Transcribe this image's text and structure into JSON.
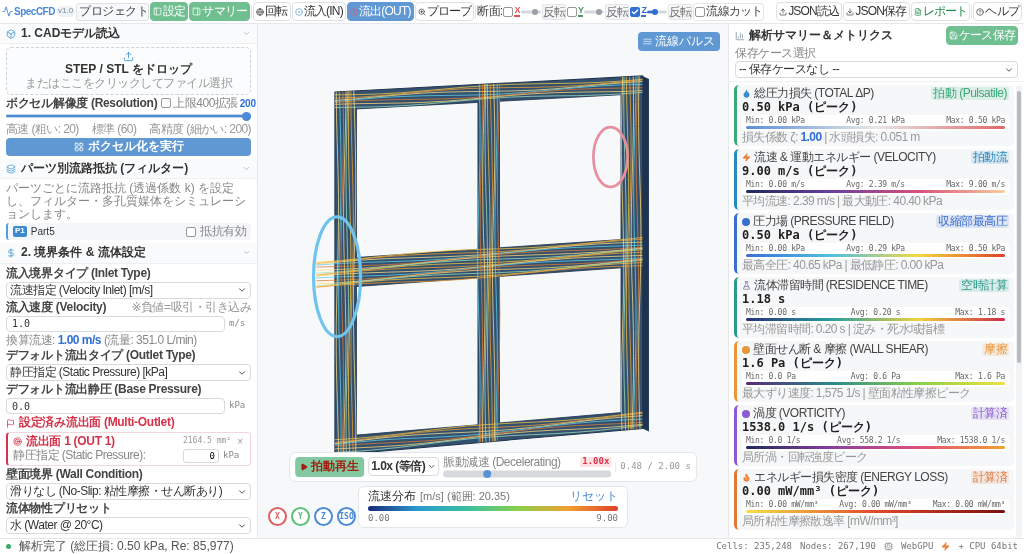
{
  "app": {
    "name": "SpecCFD",
    "version": "v1.0",
    "project": "プロジェクト"
  },
  "toolbar": {
    "panel_buttons": [
      {
        "label": "設定",
        "on": true
      },
      {
        "label": "サマリー",
        "on": true
      }
    ],
    "modes": [
      {
        "label": "回転",
        "kind": "globe",
        "selected": false
      },
      {
        "label": "流入(IN)",
        "kind": "inlet",
        "selected": false
      },
      {
        "label": "流出(OUT)",
        "kind": "outlet",
        "selected": true
      },
      {
        "label": "プローブ",
        "kind": "probe",
        "selected": false
      }
    ],
    "section_label": "断面:",
    "sections": [
      {
        "axis": "X",
        "color": "#e05555",
        "checked": false,
        "level": 0.8,
        "flip": "反転"
      },
      {
        "axis": "Y",
        "color": "#4a9a6a",
        "checked": false,
        "level": 0.8,
        "flip": "反転"
      },
      {
        "axis": "Z",
        "color": "#2f6fd6",
        "checked": true,
        "level": 0.3,
        "flip": "反転"
      }
    ],
    "streamline_cut": {
      "label": "流線カット",
      "checked": false
    },
    "actions": [
      {
        "label": "JSON読込",
        "kind": "upload"
      },
      {
        "label": "JSON保存",
        "kind": "download"
      },
      {
        "label": "レポート",
        "kind": "report"
      },
      {
        "label": "ヘルプ",
        "kind": "help"
      }
    ]
  },
  "cad": {
    "title": "1. CADモデル読込",
    "drop_title": "STEP / STL をドロップ",
    "drop_hint": "またはここをクリックしてファイル選択",
    "resolution": {
      "label": "ボクセル解像度 (Resolution)",
      "extend": {
        "label": "上限400拡張",
        "checked": false
      },
      "value": "200",
      "level": 1,
      "ticks": [
        "高速 (粗い: 20)",
        "標準 (60)",
        "高精度 (細かい: 200)"
      ]
    },
    "button": "ボクセル化を実行"
  },
  "filter": {
    "title": "パーツ別流路抵抗 (フィルター)",
    "description": "パーツごとに流路抵抗 (透過係数 k) を設定し、フィルター・多孔質媒体をシミュレーションします。",
    "parts": [
      {
        "tag": "P1",
        "name": "Part5",
        "resistance": {
          "label": "抵抗有効",
          "checked": false
        }
      }
    ]
  },
  "boundary": {
    "title": "2. 境界条件 & 流体設定",
    "fields": [
      {
        "kind": "select",
        "label": "流入境界タイプ (Inlet Type)",
        "value": "流速指定 (Velocity Inlet) [m/s]"
      },
      {
        "kind": "input",
        "label": "流入速度 (Velocity)",
        "hint": "※負値=吸引・引き込み",
        "value": "1.0",
        "unit": "m/s",
        "note": "換算流速: **1.00 m/s** (流量: 351.0 L/min)"
      },
      {
        "kind": "select",
        "label": "デフォルト流出タイプ (Outlet Type)",
        "value": "静圧指定 (Static Pressure) [kPa]"
      },
      {
        "kind": "input",
        "label": "デフォルト流出静圧 (Base Pressure)",
        "value": "0.0",
        "unit": "kPa"
      },
      {
        "kind": "outlets",
        "label": "設定済み流出面 (Multi-Outlet)",
        "items": [
          {
            "name": "流出面 1 (OUT 1)",
            "area": "2164.5 mm²",
            "remove": "×",
            "pressure_label": "静圧指定 (Static Pressure):",
            "value": "0",
            "unit": "kPa"
          }
        ]
      },
      {
        "kind": "select",
        "label": "壁面境界 (Wall Condition)",
        "value": "滑りなし (No-Slip: 粘性摩擦・せん断あり)"
      },
      {
        "kind": "select",
        "label": "流体物性プリセット",
        "value": "水 (Water @ 20°C)"
      }
    ]
  },
  "viewport": {
    "pulse_button": "流線パルス",
    "playback": {
      "play": "拍動再生",
      "speed": "1.0x (等倍)",
      "mode_label": "脈動減速 (Decelerating)",
      "rate": "1.00x",
      "level": 0.25,
      "time": "0.48 / 2.00 s"
    },
    "legend": {
      "title": "流速分布",
      "unit": "[m/s] (範囲: 20.35)",
      "reset": "リセット",
      "min": "0.00",
      "max": "9.00"
    },
    "view_buttons": [
      {
        "label": "X",
        "color": "#e06060"
      },
      {
        "label": "Y",
        "color": "#5cbf7a"
      },
      {
        "label": "Z",
        "color": "#4a8ad6"
      },
      {
        "label": "ISO",
        "color": "#4a8ad6"
      }
    ]
  },
  "summary": {
    "title": "解析サマリー＆メトリクス",
    "save": "ケース保存",
    "case_label": "保存ケース選択",
    "case_value": "-- 保存ケースなし --",
    "metrics": [
      {
        "kind": "drop",
        "color": "#3aaa7a",
        "title": "総圧力損失 (TOTAL ΔP)",
        "badge": "拍動 (Pulsatile)",
        "value": "0.50 kPa (ピーク)",
        "min": "Min: 0.00 kPa",
        "avg": "Avg: 0.21 kPa",
        "max": "Max: 0.50 kPa",
        "footer": "損失係数 ζ: **1.00** | 水頭損失: 0.051 m"
      },
      {
        "kind": "bolt",
        "color": "#2a8ac0",
        "title": "流速 & 運動エネルギー (VELOCITY)",
        "badge": "拍動流",
        "value": "9.00 m/s (ピーク)",
        "min": "Min: 0.00 m/s",
        "avg": "Avg: 2.39 m/s",
        "max": "Max: 9.00 m/s",
        "footer": "平均流速: 2.39 m/s | 最大動圧: 40.40 kPa"
      },
      {
        "kind": "dot",
        "color": "#3a6fd0",
        "title": "圧力場 (PRESSURE FIELD)",
        "badge": "収縮部最高圧",
        "value": "0.50 kPa (ピーク)",
        "min": "Min: 0.00 kPa",
        "avg": "Avg: 0.29 kPa",
        "max": "Max: 0.50 kPa",
        "footer": "最高全圧: 40.65 kPa | 最低静圧: 0.00 kPa"
      },
      {
        "kind": "flask",
        "color": "#2a9a8a",
        "title": "流体滞留時間 (RESIDENCE TIME)",
        "badge": "空時計算",
        "value": "1.18 s",
        "min": "Min: 0.00 s",
        "avg": "Avg: 0.20 s",
        "max": "Max: 1.18 s",
        "footer": "平均滞留時間: 0.20 s | 淀み・死水域指標"
      },
      {
        "kind": "dot",
        "color": "#e8963a",
        "title": "壁面せん断 & 摩擦 (WALL SHEAR)",
        "badge": "摩擦",
        "value": "1.6 Pa (ピーク)",
        "min": "Min: 0.0 Pa",
        "avg": "Avg: 0.6 Pa",
        "max": "Max: 1.6 Pa",
        "footer": "最大ずり速度: 1,575 1/s | 壁面粘性摩擦ピーク"
      },
      {
        "kind": "dot",
        "color": "#8a5ad0",
        "title": "渦度 (VORTICITY)",
        "badge": "計算済",
        "value": "1538.0 1/s (ピーク)",
        "min": "Min: 0.0 1/s",
        "avg": "Avg: 558.2 1/s",
        "max": "Max: 1538.0 1/s",
        "footer": "局所渦・回転強度ピーク"
      },
      {
        "kind": "flame",
        "color": "#e0783a",
        "title": "エネルギー損失密度 (ENERGY LOSS)",
        "badge": "計算済",
        "value": "0.00 mW/mm³ (ピーク)",
        "min": "Min: 0.00 mW/mm³",
        "avg": "Avg: 0.00 mW/mm³",
        "max": "Max: 0.00 mW/mm³",
        "footer": "局所粘性摩擦散逸率 [mW/mm³]"
      }
    ]
  },
  "status_bar": {
    "ok": true,
    "status": "解析完了 (総圧損: 0.50 kPa, Re: 85,977)",
    "cells": "Cells: 235,248",
    "nodes": "Nodes: 267,190",
    "engine": "WebGPU",
    "cpu": "+ CPU 64bit"
  }
}
